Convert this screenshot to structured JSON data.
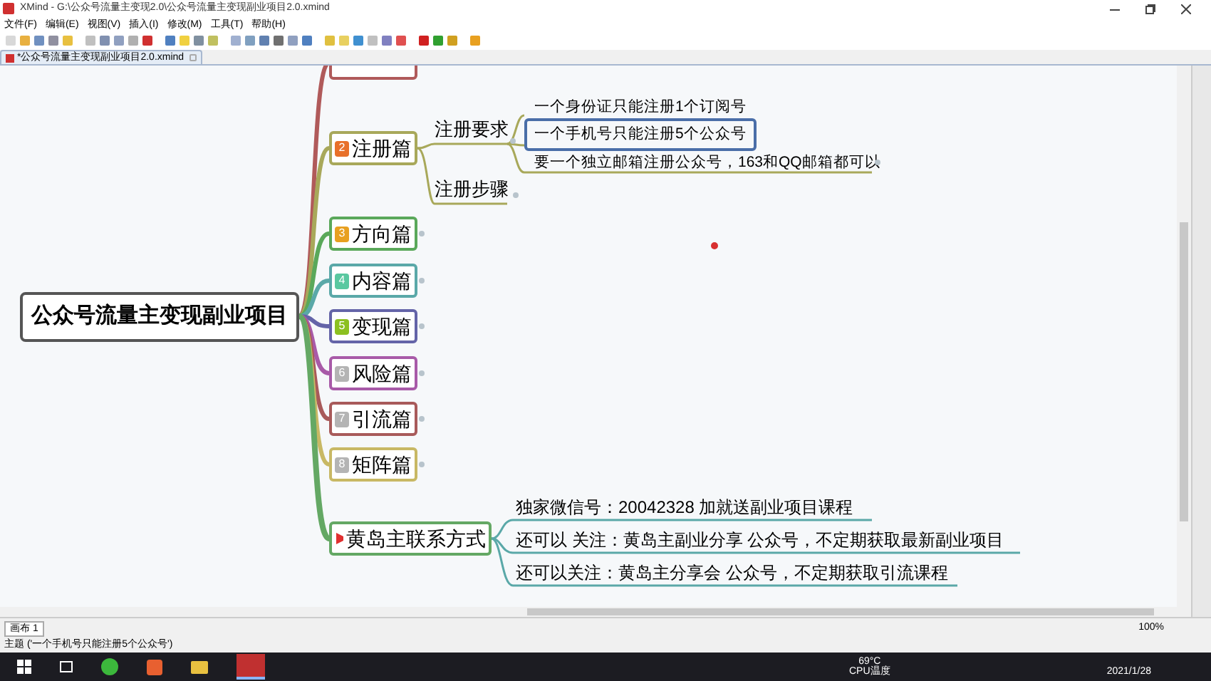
{
  "window": {
    "title": "XMind - G:\\公众号流量主变现2.0\\公众号流量主变现副业项目2.0.xmind"
  },
  "menu": [
    "文件(F)",
    "编辑(E)",
    "视图(V)",
    "插入(I)",
    "修改(M)",
    "工具(T)",
    "帮助(H)"
  ],
  "document_tab": {
    "title": "*公众号流量主变现副业项目2.0.xmind"
  },
  "mindmap": {
    "central": "公众号流量主变现副业项目",
    "branches": [
      {
        "kind": "cut",
        "color": "#b05a5a"
      },
      {
        "kind": "topic",
        "label": "注册篇",
        "color": "#a8a85a",
        "badge": {
          "number": "2",
          "color": "#e8702a"
        },
        "children": [
          {
            "label": "注册要求",
            "children": [
              {
                "label": "一个身份证只能注册1个订阅号",
                "selected": false
              },
              {
                "label": "一个手机号只能注册5个公众号",
                "selected": true
              },
              {
                "label": "要一个独立邮箱注册公众号，163和QQ邮箱都可以",
                "selected": false
              }
            ]
          },
          {
            "label": "注册步骤"
          }
        ]
      },
      {
        "kind": "topic",
        "label": "方向篇",
        "color": "#5aa85a",
        "badge": {
          "number": "3",
          "color": "#e8a020"
        }
      },
      {
        "kind": "topic",
        "label": "内容篇",
        "color": "#5aa8a8",
        "badge": {
          "number": "4",
          "color": "#5ac8a0"
        }
      },
      {
        "kind": "topic",
        "label": "变现篇",
        "color": "#6464a8",
        "badge": {
          "number": "5",
          "color": "#8cc020"
        }
      },
      {
        "kind": "topic",
        "label": "风险篇",
        "color": "#a85aa8",
        "badge": {
          "number": "6",
          "color": "#b4b4b4"
        }
      },
      {
        "kind": "topic",
        "label": "引流篇",
        "color": "#a85a5a",
        "badge": {
          "number": "7",
          "color": "#b4b4b4"
        }
      },
      {
        "kind": "topic",
        "label": "矩阵篇",
        "color": "#c8b864",
        "badge": {
          "number": "8",
          "color": "#b4b4b4"
        }
      },
      {
        "kind": "flag",
        "label": "黄岛主联系方式",
        "color": "#64a864",
        "children": [
          {
            "label": "独家微信号：20042328 加就送副业项目课程"
          },
          {
            "label": "还可以 关注：黄岛主副业分享 公众号，不定期获取最新副业项目"
          },
          {
            "label": "还可以关注：黄岛主分享会 公众号，不定期获取引流课程"
          }
        ]
      }
    ]
  },
  "sheet_tab": {
    "label": "画布 1"
  },
  "zoom": "100%",
  "status_text": "主题 ('一个手机号只能注册5个公众号')",
  "taskbar": {
    "temperature": "69°C",
    "temperature_label": "CPU温度",
    "date": "2021/1/28"
  }
}
